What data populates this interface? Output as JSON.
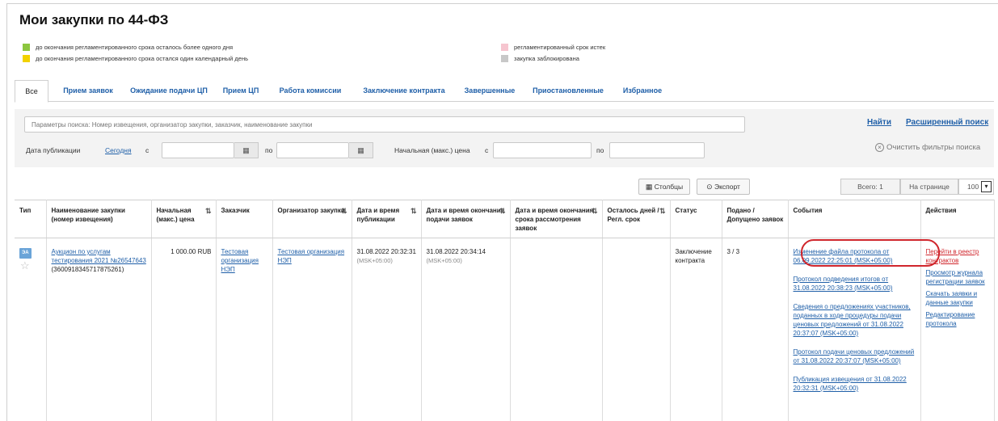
{
  "page": {
    "title": "Мои закупки по 44-ФЗ"
  },
  "legend": [
    {
      "color": "#8cc63f",
      "text": "до окончания регламентированного срока осталось более одного дня"
    },
    {
      "color": "#f2d200",
      "text": "до окончания регламентированного срока остался один календарный день"
    },
    {
      "color": "#f6c5cf",
      "text": "регламентированный срок истек"
    },
    {
      "color": "#c8c8c8",
      "text": "закупка заблокирована"
    }
  ],
  "tabs": [
    {
      "label": "Все"
    },
    {
      "label": "Прием заявок"
    },
    {
      "label": "Ожидание подачи ЦП"
    },
    {
      "label": "Прием ЦП"
    },
    {
      "label": "Работа комиссии"
    },
    {
      "label": "Заключение контракта"
    },
    {
      "label": "Завершенные"
    },
    {
      "label": "Приостановленные"
    },
    {
      "label": "Избранное"
    }
  ],
  "search": {
    "placeholder": "Параметры поиска: Номер извещения, организатор закупки, заказчик, наименование закупки",
    "find_label": "Найти",
    "advanced_label": "Расширенный поиск",
    "clear_label": "Очистить фильтры поиска",
    "pub_date_label": "Дата публикации",
    "today_label": "Сегодня",
    "from_label": "с",
    "to_label": "по",
    "price_label": "Начальная (макс.) цена",
    "price_from_label": "с",
    "price_to_label": "по"
  },
  "toolbar": {
    "columns_label": "Столбцы",
    "export_label": "Экспорт",
    "total_label": "Всего: 1",
    "per_page_label": "На странице",
    "per_page_value": "100"
  },
  "table": {
    "headers": [
      "Тип",
      "Наименование закупки (номер извещения)",
      "Начальная (макс.) цена",
      "Заказчик",
      "Организатор закупки",
      "Дата и время публикации",
      "Дата и время окончания подачи заявок",
      "Дата и время окончания срока рассмотрения заявок",
      "Осталось дней / Регл. срок",
      "Статус",
      "Подано / Допущено заявок",
      "События",
      "Действия"
    ],
    "row": {
      "type_badge": "ЭА",
      "name_link": "Аукцион по услугам тестирования 2021 №26547643",
      "notice_number": "(3600918345717875261)",
      "price": "1 000.00 RUB",
      "customer": "Тестовая организация НЭП",
      "organizer": "Тестовая организация НЭП",
      "pub_date": "31.08.2022 20:32:31",
      "pub_tz": "(MSK+05:00)",
      "end_date": "31.08.2022 20:34:14",
      "end_tz": "(MSK+05:00)",
      "review_date": "",
      "days_left": "",
      "status": "Заключение контракта",
      "applications": "3 / 3",
      "events": [
        "Изменение файла протокола от 06.09.2022 22:25:01 (MSK+05:00)",
        "Протокол подведения итогов от 31.08.2022 20:38:23 (MSK+05:00)",
        "Сведения о предложениях участников, поданных в ходе процедуры подачи ценовых предложений от 31.08.2022 20:37:07 (MSK+05:00)",
        "Протокол подачи ценовых предложений от 31.08.2022 20:37:07 (MSK+05:00)",
        "Публикация извещения от 31.08.2022 20:32:31 (MSK+05:00)"
      ],
      "actions": [
        {
          "label": "Перейти в реестр контрактов",
          "color": "#d0262c"
        },
        {
          "label": "Просмотр журнала регистрации заявок",
          "color": "#1f5fa8"
        },
        {
          "label": "Скачать заявки и данные закупки",
          "color": "#1f5fa8"
        },
        {
          "label": "Редактирование протокола",
          "color": "#1f5fa8"
        }
      ]
    }
  }
}
